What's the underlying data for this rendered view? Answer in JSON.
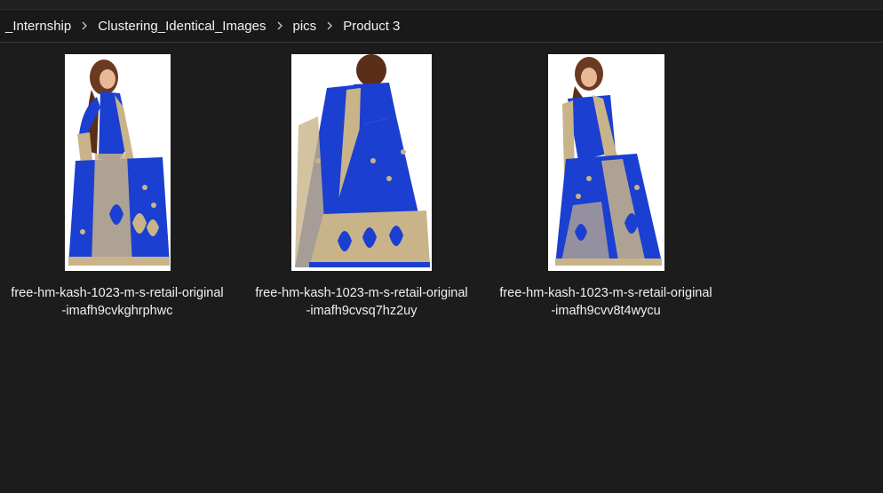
{
  "breadcrumb": {
    "items": [
      {
        "label": "_Internship"
      },
      {
        "label": "Clustering_Identical_Images"
      },
      {
        "label": "pics"
      },
      {
        "label": "Product 3"
      }
    ]
  },
  "files": [
    {
      "line1": "free-hm-kash-1023-m-s-retail-original",
      "line2": "-imafh9cvkghrphwc"
    },
    {
      "line1": "free-hm-kash-1023-m-s-retail-original",
      "line2": "-imafh9cvsq7hz2uy"
    },
    {
      "line1": "free-hm-kash-1023-m-s-retail-original",
      "line2": "-imafh9cvv8t4wycu"
    }
  ],
  "colors": {
    "background": "#1c1c1c",
    "saree_blue": "#1a3fd1",
    "zari_gold": "#c9b48a"
  },
  "icons": [
    "chevron-right-icon"
  ]
}
